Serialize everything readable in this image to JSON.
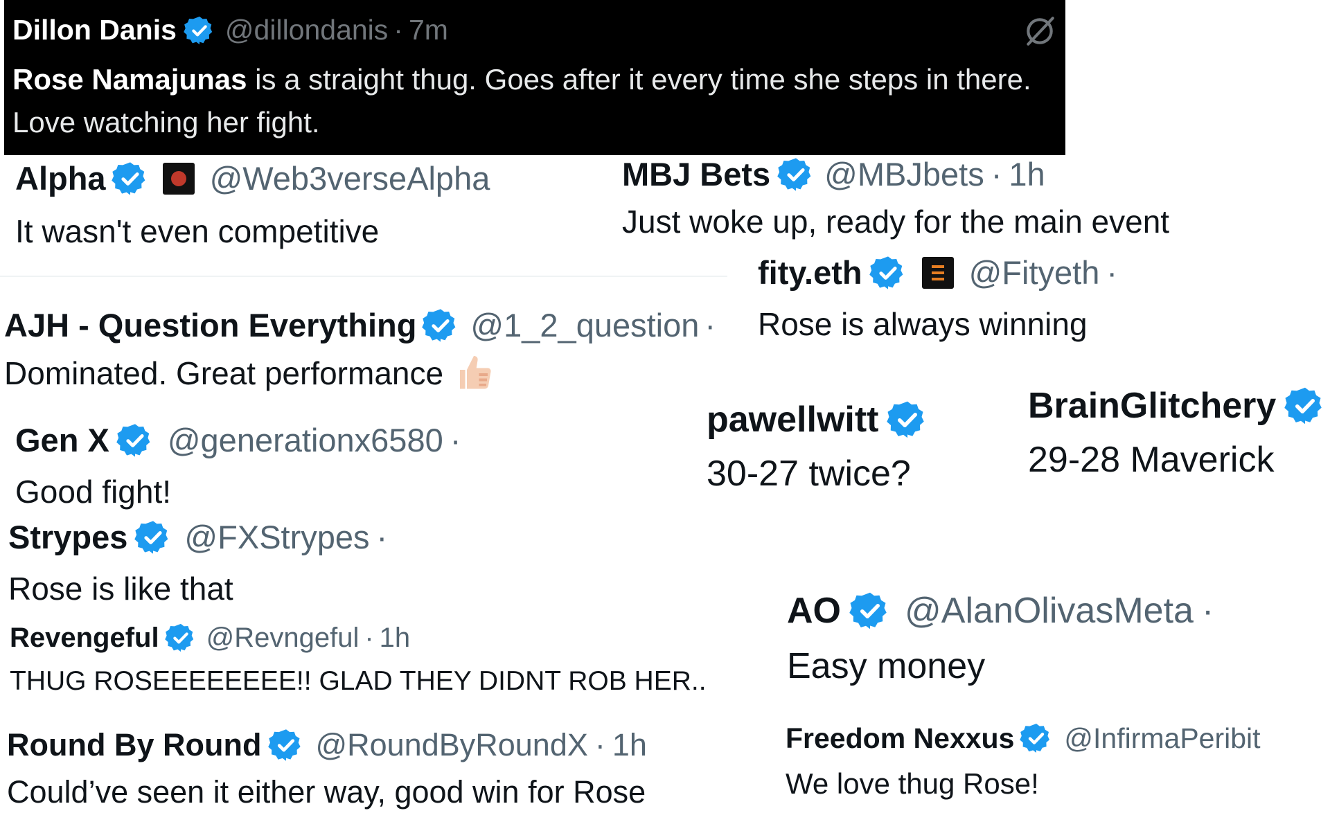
{
  "tweets": [
    {
      "name": "Dillon Danis",
      "handle": "@dillondanis",
      "time": "7m",
      "text_bold": "Rose Namajunas",
      "text": "is a straight thug. Goes after it every time she steps in there. Love watching her fight."
    },
    {
      "name": "Alpha",
      "handle": "@Web3verseAlpha",
      "time": "",
      "text": "It wasn't even competitive"
    },
    {
      "name": "MBJ Bets",
      "handle": "@MBJbets",
      "time": "1h",
      "text": "Just woke up, ready for the main event"
    },
    {
      "name": "fity.eth",
      "handle": "@Fityeth",
      "time": "",
      "text": "Rose is always winning"
    },
    {
      "name": "AJH - Question Everything",
      "handle": "@1_2_question",
      "time": "",
      "text": "Dominated. Great performance"
    },
    {
      "name": "Gen X",
      "handle": "@generationx6580",
      "time": "",
      "text": "Good fight!"
    },
    {
      "name": "pawellwitt",
      "handle": "",
      "time": "",
      "text": "30-27 twice?"
    },
    {
      "name": "BrainGlitchery",
      "handle": "",
      "time": "",
      "text": "29-28 Maverick"
    },
    {
      "name": "Strypes",
      "handle": "@FXStrypes",
      "time": "",
      "text": "Rose is like that"
    },
    {
      "name": "Revengeful",
      "handle": "@Revngeful",
      "time": "1h",
      "text": "THUG ROSEEEEEEEE!! GLAD THEY DIDNT ROB HER.."
    },
    {
      "name": "AO",
      "handle": "@AlanOlivasMeta",
      "time": "",
      "text": "Easy money"
    },
    {
      "name": "Round By Round",
      "handle": "@RoundByRoundX",
      "time": "1h",
      "text": "Could’ve seen it either way, good win for Rose"
    },
    {
      "name": "Freedom Nexxus",
      "handle": "@InfirmaPeribit",
      "time": "",
      "text": "We love thug Rose!"
    }
  ],
  "separator": "·",
  "colors": {
    "verified": "#1d9bf0",
    "name": "#0f1419",
    "handle": "#536471",
    "dark_bg": "#000000"
  },
  "icons": {
    "verified": "verified-badge-icon",
    "grok": "grok-icon",
    "thumbs_up": "thumbs-up-icon"
  }
}
